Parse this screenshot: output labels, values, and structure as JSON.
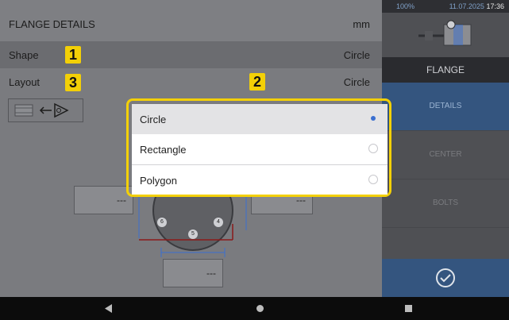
{
  "header": {
    "title": "FLANGE DETAILS",
    "unit": "mm"
  },
  "rows": {
    "shape": {
      "label": "Shape",
      "value": "Circle"
    },
    "layout": {
      "label": "Layout",
      "value": "Circle"
    }
  },
  "badges": {
    "one": "1",
    "two": "2",
    "three": "3"
  },
  "fields": {
    "left": "---",
    "right": "---",
    "bottom": "---"
  },
  "bolt_labels": [
    "6",
    "5",
    "4"
  ],
  "dropdown": {
    "options": [
      {
        "label": "Circle",
        "selected": true
      },
      {
        "label": "Rectangle",
        "selected": false
      },
      {
        "label": "Polygon",
        "selected": false
      }
    ]
  },
  "status": {
    "battery": "100%",
    "date": "11.07.2025",
    "time": "17:36"
  },
  "sidebar": {
    "title": "FLANGE",
    "items": [
      {
        "label": "DETAILS",
        "active": true
      },
      {
        "label": "CENTER",
        "active": false
      },
      {
        "label": "BOLTS",
        "active": false
      }
    ]
  },
  "icons": {
    "confirm": "checkmark-circle-icon",
    "back": "triangle-back-icon",
    "home": "circle-home-icon",
    "recents": "square-recents-icon"
  },
  "colors": {
    "highlight": "#f3d007",
    "accent": "#34557f",
    "radio": "#3a6fd0"
  }
}
